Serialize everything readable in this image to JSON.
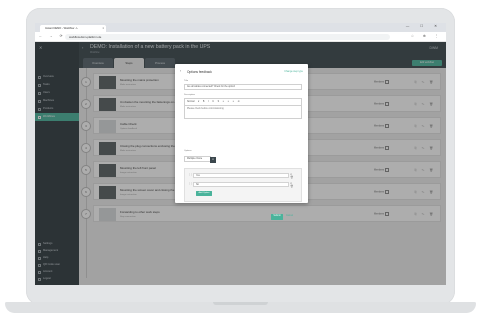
{
  "browser": {
    "tab_title": "Instant DEMO - Workflow - L",
    "tab_close": "×",
    "window_controls": "— ☐ ✕",
    "nav_buttons": "← → ⟳ ⌂",
    "url": "workflow.dwm-platform.de",
    "icons": "☆ ⊕ ⋮"
  },
  "sidebar": {
    "close_glyph": "✕",
    "items": [
      {
        "label": "Overview"
      },
      {
        "label": "Tasks"
      },
      {
        "label": "Users"
      },
      {
        "label": "Machines"
      },
      {
        "label": "Products"
      },
      {
        "label": "Workflows"
      }
    ],
    "bottom_items": [
      {
        "label": "Settings"
      },
      {
        "label": "Management"
      },
      {
        "label": "Help"
      },
      {
        "label": "QR Code scan"
      },
      {
        "label": "Account"
      },
      {
        "label": "Logout"
      }
    ]
  },
  "header": {
    "back": "‹",
    "title": "DEMO: Installation of a new battery pack in the UPS",
    "subtitle": "Workflow",
    "logo": "DWM"
  },
  "tabs": [
    {
      "label": "Overview"
    },
    {
      "label": "Steps"
    },
    {
      "label": "Process"
    }
  ],
  "edit_button": "Edit workflow",
  "steps": [
    {
      "num": "1",
      "title": "Mounting the mains protection",
      "sub": "Make instruction",
      "resp": "Members"
    },
    {
      "num": "2",
      "title": "Un-Fasten the mounting the fastenings on cover",
      "sub": "Make instruction",
      "resp": "Members"
    },
    {
      "num": "3",
      "title": "Cable Check",
      "sub": "Options feedback",
      "resp": "Members"
    },
    {
      "num": "4",
      "title": "Closing the plug connections enclosing the battery pack",
      "sub": "Make instruction",
      "resp": "Members"
    },
    {
      "num": "5",
      "title": "Mounting the left front panel",
      "sub": "Image instruction",
      "resp": "Members"
    },
    {
      "num": "6",
      "title": "Mounting the screen cover and closing the casing",
      "sub": "Image instruction",
      "resp": "Members"
    },
    {
      "num": "7",
      "title": "Forwarding to other work steps",
      "sub": "Step connection",
      "resp": "Members"
    }
  ],
  "step_actions": "⎘ ✎ 🗑",
  "modal": {
    "back": "‹",
    "title": "Options feedback",
    "link": "Change step type",
    "title_label": "Title",
    "title_value": "Are all cables connected? Check for the option!",
    "desc_label": "Description",
    "toolbar": "Normal ▾  B  I  U  S  ≡  ≡  ≡  ⊘",
    "editor_placeholder": "Please check before commissioning",
    "options_label": "Options",
    "select_value": "Multiple choice",
    "select_chev": "▾",
    "opt_drag": "⋮⋮",
    "opt_icons": "⊘ 🗑",
    "options": [
      {
        "label": "Yes"
      },
      {
        "label": "No"
      }
    ],
    "add_option": "Add Option",
    "save": "Submit",
    "cancel": "Cancel"
  }
}
